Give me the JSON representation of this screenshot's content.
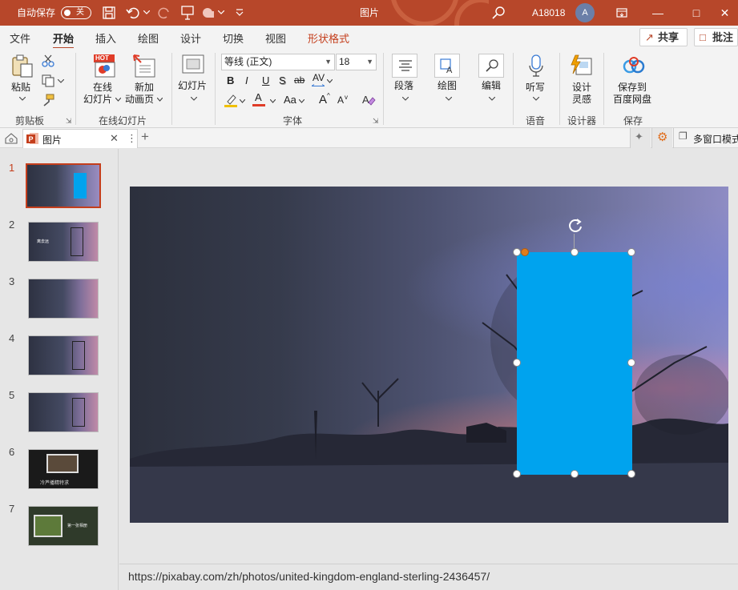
{
  "titlebar": {
    "autosave_label": "自动保存",
    "autosave_state": "关",
    "doc_title": "图片",
    "user_name": "A18018",
    "avatar_letter": "A",
    "accent": "#b7472a"
  },
  "tabs": [
    {
      "label": "文件"
    },
    {
      "label": "开始",
      "active": true
    },
    {
      "label": "插入"
    },
    {
      "label": "绘图"
    },
    {
      "label": "设计"
    },
    {
      "label": "切换"
    },
    {
      "label": "视图"
    },
    {
      "label": "形状格式",
      "contextual": true
    }
  ],
  "header_buttons": {
    "share": "共享",
    "comment": "批注"
  },
  "ribbon": {
    "paste": "粘贴",
    "clipboard_group": "剪贴板",
    "online_slides_line1": "在线",
    "online_slides_line2": "幻灯片",
    "new_anim_line1": "新加",
    "new_anim_line2": "动画页",
    "hot_badge": "HOT",
    "online_group": "在线幻灯片",
    "slides": "幻灯片",
    "font_name": "等线 (正文)",
    "font_size": "18",
    "font_group": "字体",
    "bold": "B",
    "italic": "I",
    "underline": "U",
    "shadow": "S",
    "strike": "ab",
    "spacing": "AV",
    "font_color": "A",
    "change_case": "Aa",
    "grow_font": "A",
    "shrink_font": "A",
    "paragraph": "段落",
    "drawing": "绘图",
    "editing": "编辑",
    "dictate": "听写",
    "voice_group": "语音",
    "designer_line1": "设计",
    "designer_line2": "灵感",
    "designer_group": "设计器",
    "baidu_line1": "保存到",
    "baidu_line2": "百度网盘",
    "save_group": "保存"
  },
  "docbar": {
    "tab_label": "图片",
    "multiwindow": "多窗口模式"
  },
  "thumbnails": [
    {
      "num": "1",
      "active": true
    },
    {
      "num": "2",
      "caption": "离去远"
    },
    {
      "num": "3"
    },
    {
      "num": "4"
    },
    {
      "num": "5"
    },
    {
      "num": "6",
      "caption": "冷芦播精特求"
    },
    {
      "num": "7",
      "caption": "第一张相册"
    }
  ],
  "shape": {
    "fill": "#00a3ee"
  },
  "notes": {
    "text": "https://pixabay.com/zh/photos/united-kingdom-england-sterling-2436457/"
  }
}
